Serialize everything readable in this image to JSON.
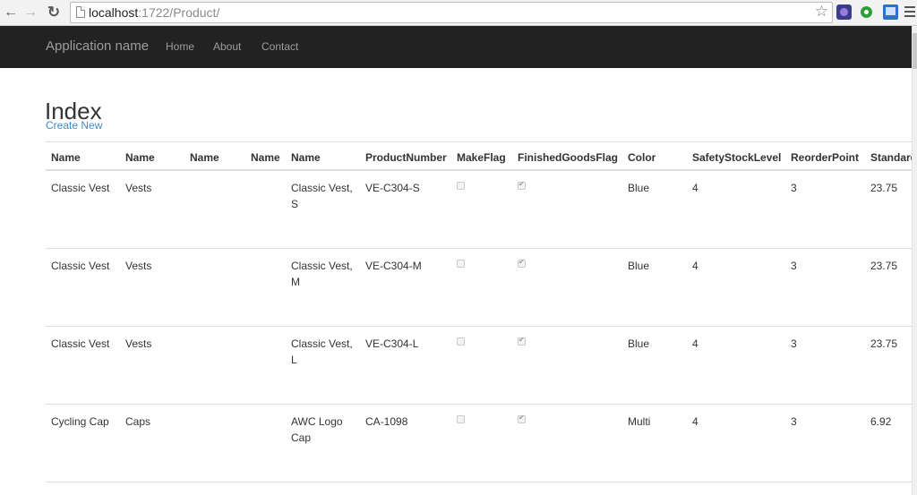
{
  "browser": {
    "url_host": "localhost",
    "url_rest": ":1722/Product/"
  },
  "navbar": {
    "brand": "Application name",
    "links": [
      "Home",
      "About",
      "Contact"
    ]
  },
  "page": {
    "title": "Index",
    "create_link": "Create New"
  },
  "table": {
    "headers": [
      "Name",
      "Name",
      "Name",
      "Name",
      "Name",
      "ProductNumber",
      "MakeFlag",
      "FinishedGoodsFlag",
      "Color",
      "SafetyStockLevel",
      "ReorderPoint",
      "Standard"
    ],
    "rows": [
      {
        "name1": "Classic Vest",
        "name2": "Vests",
        "name3": "",
        "name4": "",
        "name5": "Classic Vest, S",
        "product_number": "VE-C304-S",
        "make_flag": false,
        "finished_goods_flag": true,
        "color": "Blue",
        "safety_stock_level": "4",
        "reorder_point": "3",
        "standard_cost": "23.75"
      },
      {
        "name1": "Classic Vest",
        "name2": "Vests",
        "name3": "",
        "name4": "",
        "name5": "Classic Vest, M",
        "product_number": "VE-C304-M",
        "make_flag": false,
        "finished_goods_flag": true,
        "color": "Blue",
        "safety_stock_level": "4",
        "reorder_point": "3",
        "standard_cost": "23.75"
      },
      {
        "name1": "Classic Vest",
        "name2": "Vests",
        "name3": "",
        "name4": "",
        "name5": "Classic Vest, L",
        "product_number": "VE-C304-L",
        "make_flag": false,
        "finished_goods_flag": true,
        "color": "Blue",
        "safety_stock_level": "4",
        "reorder_point": "3",
        "standard_cost": "23.75"
      },
      {
        "name1": "Cycling Cap",
        "name2": "Caps",
        "name3": "",
        "name4": "",
        "name5": "AWC Logo Cap",
        "product_number": "CA-1098",
        "make_flag": false,
        "finished_goods_flag": true,
        "color": "Multi",
        "safety_stock_level": "4",
        "reorder_point": "3",
        "standard_cost": "6.92"
      }
    ]
  }
}
